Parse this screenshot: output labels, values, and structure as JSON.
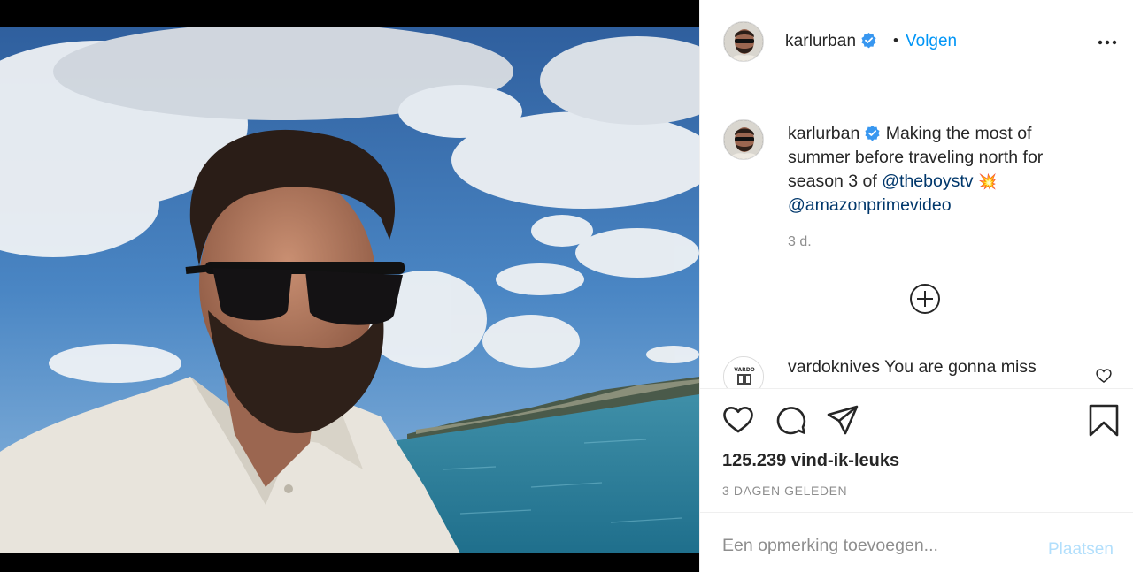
{
  "post": {
    "username": "karlurban",
    "verified": true,
    "follow_separator": "•",
    "follow_label": "Volgen",
    "more_icon": "more-horizontal-icon"
  },
  "caption": {
    "username": "karlurban",
    "text_1": "Making the most of summer before traveling north for season 3 of",
    "mention_1": "@theboystv",
    "emoji": "💥",
    "mention_2": "@amazonprimevideo",
    "age": "3 d."
  },
  "comments": [
    {
      "username": "vardoknives",
      "text": "You are gonna miss"
    }
  ],
  "actions": {
    "icons": [
      "heart-icon",
      "comment-icon",
      "share-icon",
      "bookmark-icon"
    ],
    "likes": "125.239 vind-ik-leuks",
    "time_ago": "3 DAGEN GELEDEN"
  },
  "comment_input": {
    "placeholder": "Een opmerking toevoegen...",
    "value": "",
    "post_label": "Plaatsen"
  },
  "colors": {
    "link_blue": "#0095f6",
    "mention_blue": "#00376b",
    "post_disabled": "#b2dffc",
    "secondary_text": "#8e8e8e",
    "verified_badge": "#3897f0"
  }
}
